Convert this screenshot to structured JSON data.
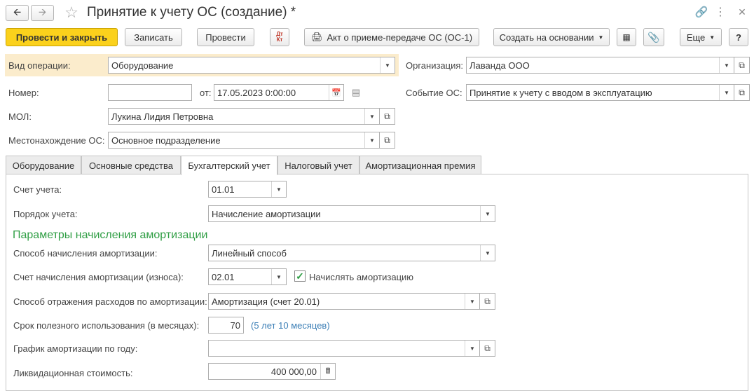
{
  "window": {
    "title": "Принятие к учету ОС (создание) *",
    "controls": {
      "link_icon": "link-icon",
      "more_icon": "kebab-icon",
      "close_icon": "close-icon"
    }
  },
  "toolbar": {
    "post_close": "Провести и закрыть",
    "save": "Записать",
    "post": "Провести",
    "dt_kt": "Дт\nКт",
    "act": "Акт о приеме-передаче ОС (ОС-1)",
    "create_based": "Создать на основании",
    "more": "Еще",
    "help": "?"
  },
  "header": {
    "operation_label": "Вид операции:",
    "operation_value": "Оборудование",
    "org_label": "Организация:",
    "org_value": "Лаванда ООО",
    "number_label": "Номер:",
    "number_value": "",
    "date_label": "от:",
    "date_value": "17.05.2023  0:00:00",
    "event_label": "Событие ОС:",
    "event_value": "Принятие к учету с вводом в эксплуатацию",
    "mol_label": "МОЛ:",
    "mol_value": "Лукина Лидия Петровна",
    "location_label": "Местонахождение ОС:",
    "location_value": "Основное подразделение"
  },
  "tabs": [
    {
      "label": "Оборудование",
      "active": false
    },
    {
      "label": "Основные средства",
      "active": false
    },
    {
      "label": "Бухгалтерский учет",
      "active": true
    },
    {
      "label": "Налоговый учет",
      "active": false
    },
    {
      "label": "Амортизационная премия",
      "active": false
    }
  ],
  "accounting": {
    "account_label": "Счет учета:",
    "account_value": "01.01",
    "order_label": "Порядок учета:",
    "order_value": "Начисление амортизации",
    "section_title": "Параметры начисления амортизации",
    "method_label": "Способ начисления амортизации:",
    "method_value": "Линейный способ",
    "depr_account_label": "Счет начисления амортизации (износа):",
    "depr_account_value": "02.01",
    "accrue_checkbox_label": "Начислять амортизацию",
    "accrue_checked": true,
    "expense_label": "Способ отражения расходов по амортизации:",
    "expense_value": "Амортизация (счет 20.01)",
    "useful_life_label": "Срок полезного использования (в месяцах):",
    "useful_life_value": "70",
    "useful_life_hint": "(5 лет 10 месяцев)",
    "schedule_label": "График амортизации по году:",
    "schedule_value": "",
    "salvage_label": "Ликвидационная стоимость:",
    "salvage_value": "400 000,00"
  },
  "colors": {
    "primary_button": "#fbd11c",
    "section_title": "#2f9e44",
    "hint": "#3c7fb6",
    "highlight": "#fbeccc"
  }
}
